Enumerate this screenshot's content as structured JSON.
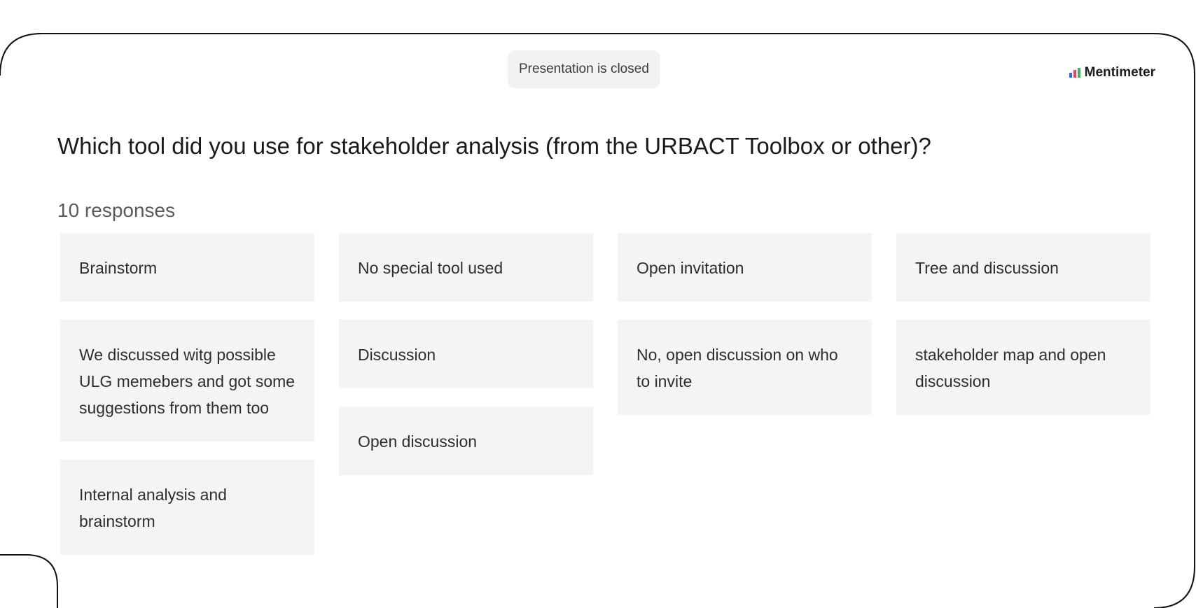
{
  "status": {
    "label": "Presentation is closed"
  },
  "brand": {
    "name": "Mentimeter",
    "colors": [
      "#3f5fe8",
      "#e8425a",
      "#46b35c"
    ]
  },
  "question": {
    "text": "Which tool did you use for stakeholder analysis (from the URBACT Toolbox or other)?",
    "responses_count": "10 responses"
  },
  "responses": {
    "columns": [
      [
        "Brainstorm",
        "We discussed witg possible ULG memebers and got some suggestions from them too",
        "Internal analysis and brainstorm"
      ],
      [
        "No special tool used",
        "Discussion",
        "Open discussion"
      ],
      [
        "Open invitation",
        "No, open discussion on who to invite"
      ],
      [
        "Tree and discussion",
        "stakeholder map and open discussion"
      ]
    ]
  }
}
